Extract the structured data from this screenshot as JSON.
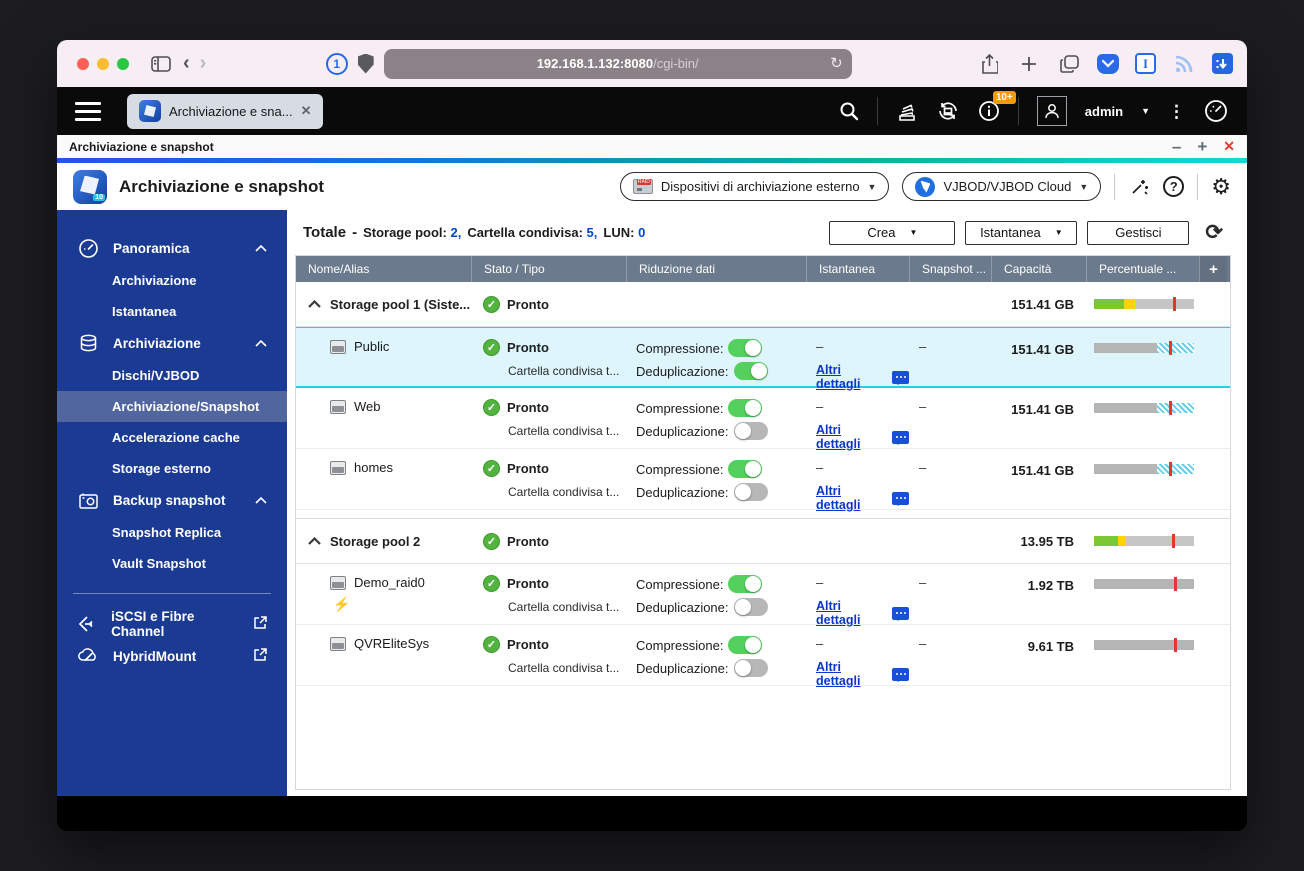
{
  "browser": {
    "url_host": "192.168.1.132:8080",
    "url_path": "/cgi-bin/"
  },
  "topbar": {
    "tab_label": "Archiviazione e sna...",
    "username": "admin",
    "notification_badge": "10+"
  },
  "app_window": {
    "title": "Archiviazione e snapshot"
  },
  "app_header": {
    "title": "Archiviazione e snapshot",
    "external_devices_button": "Dispositivi di archiviazione esterno",
    "vjbod_button": "VJBOD/VJBOD Cloud"
  },
  "sidebar": {
    "sections": [
      {
        "label": "Panoramica",
        "items": [
          "Archiviazione",
          "Istantanea"
        ]
      },
      {
        "label": "Archiviazione",
        "items": [
          "Dischi/VJBOD",
          "Archiviazione/Snapshot",
          "Accelerazione cache",
          "Storage esterno"
        ]
      },
      {
        "label": "Backup snapshot",
        "items": [
          "Snapshot Replica",
          "Vault Snapshot"
        ]
      }
    ],
    "links": [
      "iSCSI e Fibre Channel",
      "HybridMount"
    ],
    "selected_item": "Archiviazione/Snapshot"
  },
  "toolbar": {
    "summary_label": "Totale",
    "summary_sep": "-",
    "stats": [
      {
        "label": "Storage pool:",
        "value": "2,"
      },
      {
        "label": "Cartella condivisa:",
        "value": "5,"
      },
      {
        "label": "LUN:",
        "value": "0"
      }
    ],
    "create_label": "Crea",
    "snapshot_label": "Istantanea",
    "manage_label": "Gestisci"
  },
  "table": {
    "columns": [
      "Nome/Alias",
      "Stato / Tipo",
      "Riduzione dati",
      "Istantanea",
      "Snapshot ...",
      "Capacità",
      "Percentuale ...",
      "+"
    ],
    "labels": {
      "status_ready": "Pronto",
      "type_shared": "Cartella condivisa t...",
      "compression": "Compressione:",
      "dedup": "Deduplicazione:",
      "details_link": "Altri dettagli",
      "dash": "–"
    },
    "groups": [
      {
        "name": "Storage pool 1 (Siste...",
        "status": "Pronto",
        "capacity": "151.41 GB",
        "bar": {
          "segments": [
            {
              "color": "#7cc832",
              "pct": 30
            },
            {
              "color": "#ffd400",
              "pct": 11
            },
            {
              "color": "#c6c6c6",
              "pct": 59
            }
          ],
          "tick_pct": 79
        },
        "rows": [
          {
            "name": "Public",
            "capacity": "151.41 GB",
            "bar": {
              "segments": [
                {
                  "color": "#b5b5b5",
                  "pct": 63
                },
                {
                  "hatch": true,
                  "pct": 37
                }
              ],
              "tick_pct": 75
            }
          },
          {
            "name": "Web",
            "capacity": "151.41 GB",
            "bar": {
              "segments": [
                {
                  "color": "#b5b5b5",
                  "pct": 63
                },
                {
                  "hatch": true,
                  "pct": 37
                }
              ],
              "tick_pct": 75
            }
          },
          {
            "name": "homes",
            "capacity": "151.41 GB",
            "bar": {
              "segments": [
                {
                  "color": "#b5b5b5",
                  "pct": 63
                },
                {
                  "hatch": true,
                  "pct": 37
                }
              ],
              "tick_pct": 75
            }
          }
        ]
      },
      {
        "name": "Storage pool 2",
        "status": "Pronto",
        "capacity": "13.95 TB",
        "bar": {
          "segments": [
            {
              "color": "#7cc832",
              "pct": 24
            },
            {
              "color": "#ffd400",
              "pct": 8
            },
            {
              "color": "#c6c6c6",
              "pct": 68
            }
          ],
          "tick_pct": 78
        },
        "rows": [
          {
            "name": "Demo_raid0",
            "capacity": "1.92 TB",
            "bar": {
              "segments": [
                {
                  "color": "#b5b5b5",
                  "pct": 100
                }
              ],
              "tick_pct": 80
            }
          },
          {
            "name": "QVREliteSys",
            "capacity": "9.61 TB",
            "bar": {
              "segments": [
                {
                  "color": "#b5b5b5",
                  "pct": 100
                }
              ],
              "tick_pct": 80
            }
          }
        ]
      }
    ]
  }
}
